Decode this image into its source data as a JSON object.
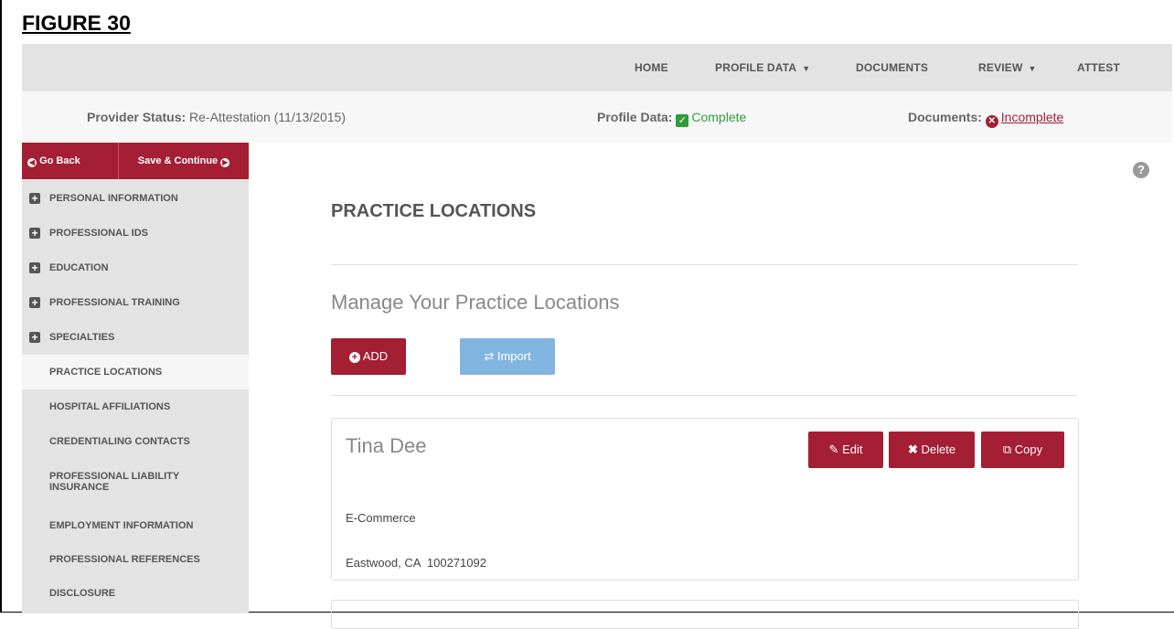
{
  "figure_title": "FIGURE 30",
  "nav": {
    "home": "HOME",
    "profile_data": "PROFILE DATA",
    "documents": "DOCUMENTS",
    "review": "REVIEW",
    "attest": "ATTEST",
    "caret": "▼"
  },
  "status": {
    "provider_label": "Provider Status:",
    "provider_value": "Re-Attestation (11/13/2015)",
    "profile_label": "Profile Data:",
    "profile_value": "Complete",
    "documents_label": "Documents:",
    "documents_value": "Incomplete"
  },
  "sidebar": {
    "back_label": "Go Back",
    "save_label": "Save & Continue",
    "items": [
      {
        "label": "PERSONAL INFORMATION"
      },
      {
        "label": "PROFESSIONAL IDS"
      },
      {
        "label": "EDUCATION"
      },
      {
        "label": "PROFESSIONAL TRAINING"
      },
      {
        "label": "SPECIALTIES"
      },
      {
        "label": "PRACTICE LOCATIONS"
      },
      {
        "label": "HOSPITAL AFFILIATIONS"
      },
      {
        "label": "CREDENTIALING CONTACTS"
      },
      {
        "label": "PROFESSIONAL LIABILITY INSURANCE"
      },
      {
        "label": "EMPLOYMENT INFORMATION"
      },
      {
        "label": "PROFESSIONAL REFERENCES"
      },
      {
        "label": "DISCLOSURE"
      }
    ]
  },
  "main": {
    "title": "PRACTICE LOCATIONS",
    "subtitle": "Manage Your Practice Locations",
    "add_label": "ADD",
    "import_label": "Import",
    "card": {
      "name": "Tina Dee",
      "edit_label": "Edit",
      "delete_label": "Delete",
      "copy_label": "Copy",
      "line1": "E-Commerce",
      "line2": "Eastwood, CA  100271092"
    }
  },
  "colors": {
    "brand_red": "#a41e34",
    "complete_green": "#2e9e3a",
    "import_blue": "#81b5e0"
  }
}
